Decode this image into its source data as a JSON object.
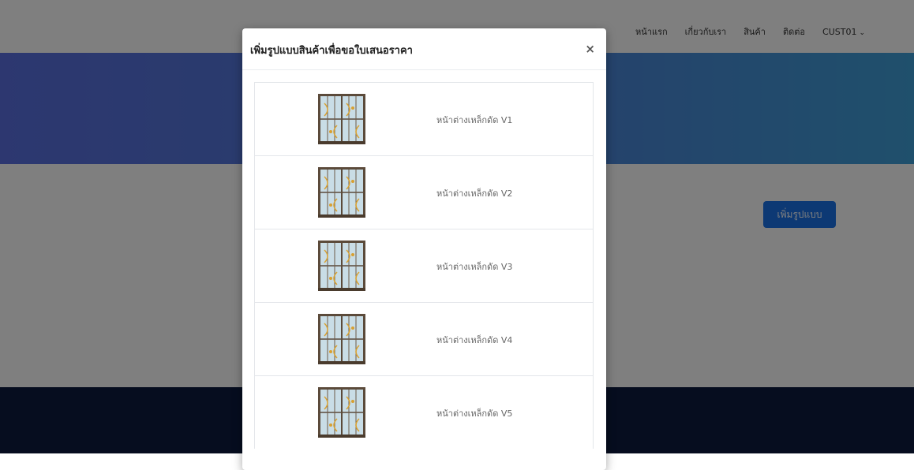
{
  "nav": {
    "links": [
      "หน้าแรก",
      "เกี่ยวกับเรา",
      "สินค้า",
      "ติดต่อ",
      "CUST01"
    ],
    "caret": "⌄"
  },
  "page": {
    "add_button": "เพิ่มรูปแบบ"
  },
  "modal": {
    "title": "เพิ่มรูปแบบสินค้าเพื่อขอใบเสนอราคา",
    "close": "×",
    "items": [
      {
        "label": "หน้าต่างเหล็กดัด V1"
      },
      {
        "label": "หน้าต่างเหล็กดัด V2"
      },
      {
        "label": "หน้าต่างเหล็กดัด V3"
      },
      {
        "label": "หน้าต่างเหล็กดัด V4"
      },
      {
        "label": "หน้าต่างเหล็กดัด V5"
      }
    ]
  },
  "colors": {
    "primary": "#1a73e8",
    "hero_start": "#5a6fe0",
    "hero_end": "#3fa0d8",
    "footer": "#0d1a3e"
  },
  "icons": {
    "thumbnail": "window-grille-icon",
    "close": "close-icon",
    "dropdown": "chevron-down-icon"
  }
}
